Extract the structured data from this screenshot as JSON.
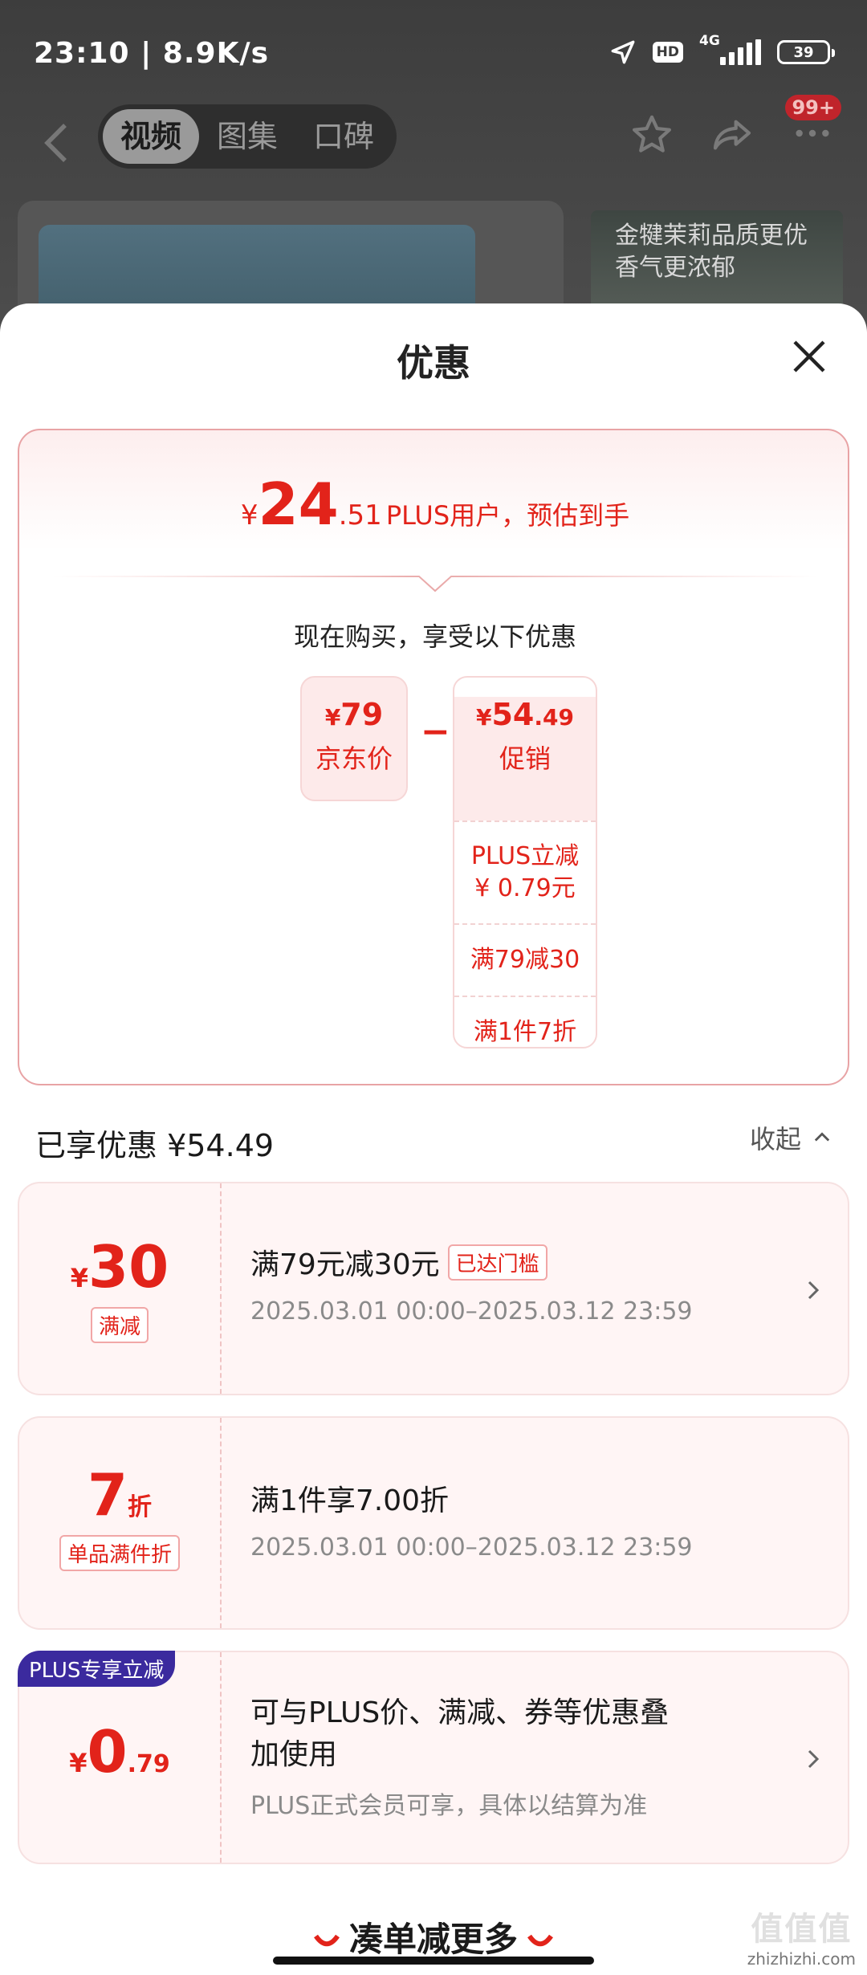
{
  "status_bar": {
    "time_speed": "23:10 | 8.9K/s",
    "hd": "HD",
    "network": "4G",
    "battery": "39"
  },
  "nav": {
    "tabs": [
      {
        "label": "视频",
        "active": true
      },
      {
        "label": "图集",
        "active": false
      },
      {
        "label": "口碑",
        "active": false
      }
    ],
    "badge": "99+",
    "back_icon": "chevron-left-icon",
    "actions": [
      "star-icon",
      "share-icon",
      "more-icon"
    ]
  },
  "background_ad": {
    "line1": "金犍茉莉品质更优",
    "line2": "香气更浓郁"
  },
  "sheet": {
    "title": "优惠",
    "estimate": {
      "currency": "¥",
      "price_int": "24",
      "price_dec": ".51",
      "label": "PLUS用户，预估到手"
    },
    "buy_label": "现在购买，享受以下优惠",
    "jd_price": {
      "currency": "¥",
      "amount": "79",
      "label": "京东价"
    },
    "minus": "−",
    "promo": {
      "currency": "¥",
      "amount_int": "54",
      "amount_dec": ".49",
      "label": "促销",
      "items": [
        "PLUS立减\n¥ 0.79元",
        "满79减30",
        "满1件7折"
      ]
    },
    "enjoyed_label": "已享优惠 ¥54.49",
    "collapse_label": "收起",
    "coupons": [
      {
        "cur": "¥",
        "num": "30",
        "suffix": "",
        "tag": "满减",
        "title": "满79元减30元",
        "reached": "已达门槛",
        "date": "2025.03.01 00:00–2025.03.12 23:59",
        "arrow": true
      },
      {
        "cur": "",
        "num": "7",
        "suffix": "折",
        "tag": "单品满件折",
        "title": "满1件享7.00折",
        "reached": "",
        "date": "2025.03.01 00:00–2025.03.12 23:59",
        "arrow": false
      },
      {
        "flag": "PLUS专享立减",
        "cur": "¥",
        "num": "0",
        "suffix": ".79",
        "tag": "",
        "title_line1": "可与PLUS价、满减、券等优惠叠",
        "title_line2": "加使用",
        "note": "PLUS正式会员可享，具体以结算为准",
        "arrow": true
      }
    ],
    "more_label": "凑单减更多"
  },
  "watermark": {
    "mark": "值值值",
    "site": "zhizhizhi.com"
  },
  "colors": {
    "accent": "#e2231a",
    "plus_flag": "#3b2a9e",
    "card_bg": "#fff5f5"
  }
}
